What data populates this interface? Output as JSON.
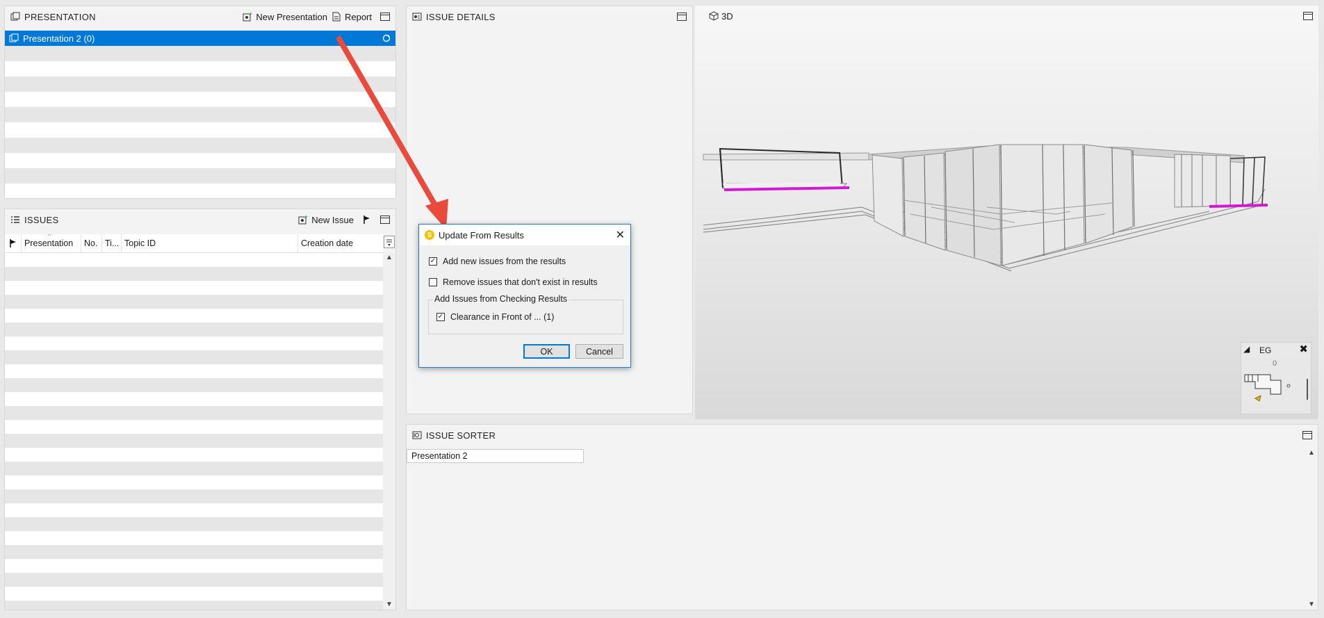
{
  "presentation_panel": {
    "title": "PRESENTATION",
    "new_presentation_label": "New Presentation",
    "report_label": "Report",
    "items": [
      {
        "label": "Presentation 2 (0)",
        "selected": true
      }
    ]
  },
  "issues_panel": {
    "title": "ISSUES",
    "new_issue_label": "New Issue",
    "columns": [
      "Presentation",
      "No.",
      "Ti...",
      "Topic ID",
      "Creation date"
    ]
  },
  "issue_details_panel": {
    "title": "ISSUE DETAILS"
  },
  "view3d_panel": {
    "title": "3D",
    "navigator_label": "EG",
    "navigator_value": "0"
  },
  "issue_sorter_panel": {
    "title": "ISSUE SORTER",
    "items": [
      "Presentation 2"
    ]
  },
  "dialog": {
    "title": "Update From Results",
    "add_new_label": "Add new issues from the results",
    "add_new_checked": true,
    "remove_label": "Remove issues that don't exist in results",
    "remove_checked": false,
    "group_label": "Add Issues from Checking Results",
    "rule_label": "Clearance in Front of ... (1)",
    "rule_checked": true,
    "ok_label": "OK",
    "cancel_label": "Cancel"
  },
  "colors": {
    "selection": "#0078d7",
    "annotation_arrow": "#e84a3c",
    "highlight_magenta": "#d21ad2"
  }
}
